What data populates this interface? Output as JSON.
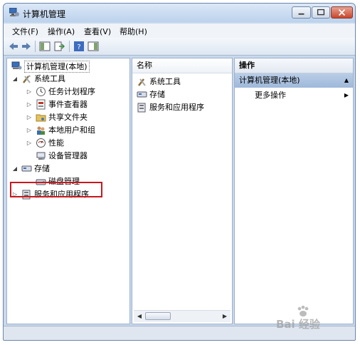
{
  "window": {
    "title": "计算机管理"
  },
  "menubar": {
    "items": [
      "文件(F)",
      "操作(A)",
      "查看(V)",
      "帮助(H)"
    ]
  },
  "tree": {
    "root": "计算机管理(本地)",
    "system_tools": "系统工具",
    "task_scheduler": "任务计划程序",
    "event_viewer": "事件查看器",
    "shared_folders": "共享文件夹",
    "local_users": "本地用户和组",
    "performance": "性能",
    "device_manager": "设备管理器",
    "storage": "存储",
    "disk_management": "磁盘管理",
    "services_apps": "服务和应用程序"
  },
  "list": {
    "header": "名称",
    "items": [
      "系统工具",
      "存储",
      "服务和应用程序"
    ]
  },
  "actions": {
    "header": "操作",
    "subheader": "计算机管理(本地)",
    "more": "更多操作"
  },
  "watermark": {
    "text": "Bai 经验"
  },
  "colors": {
    "highlight": "#c8181e",
    "accent": "#bcd2ec",
    "selected_action": "#9fb9da"
  }
}
